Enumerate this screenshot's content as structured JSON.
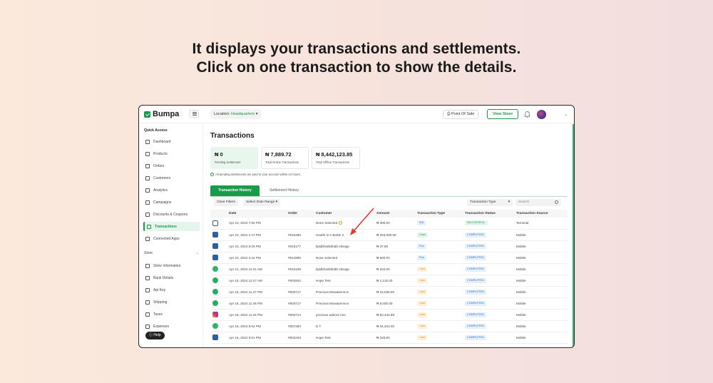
{
  "headline": {
    "line1": "It displays your transactions and settlements.",
    "line2": "Click on one transaction to show the details."
  },
  "app": {
    "logo": "Bumpa",
    "location_label": "Location:",
    "location_value": "Headquarters",
    "point_of_sale": "Point Of Sale",
    "view_store": "View Store"
  },
  "sidebar": {
    "quick_access": "Quick Access",
    "items": [
      {
        "label": "Dashboard",
        "icon": "grid-icon"
      },
      {
        "label": "Products",
        "icon": "tag-icon"
      },
      {
        "label": "Orders",
        "icon": "bag-icon"
      },
      {
        "label": "Customers",
        "icon": "user-icon"
      },
      {
        "label": "Analytics",
        "icon": "bar-chart-icon"
      },
      {
        "label": "Campaigns",
        "icon": "chat-icon"
      },
      {
        "label": "Discounts & Coupons",
        "icon": "percent-icon"
      },
      {
        "label": "Transactions",
        "icon": "swap-icon",
        "active": true
      },
      {
        "label": "Connected Apps",
        "icon": "apps-icon"
      }
    ],
    "store_section": "Store",
    "store_items": [
      {
        "label": "Store Information",
        "icon": "store-icon"
      },
      {
        "label": "Bank Details",
        "icon": "bank-icon"
      },
      {
        "label": "Api Key",
        "icon": "key-icon"
      },
      {
        "label": "Shipping",
        "icon": "truck-icon"
      },
      {
        "label": "Taxes",
        "icon": "tax-icon"
      },
      {
        "label": "Expenses",
        "icon": "receipt-icon"
      }
    ],
    "help": "Help"
  },
  "main": {
    "title": "Transactions",
    "stats": [
      {
        "value": "₦ 0",
        "label": "Pending Settlement"
      },
      {
        "value": "₦ 7,889.72",
        "label": "Total Online Transactions"
      },
      {
        "value": "₦ 8,442,123.85",
        "label": "Total Offline Transactions"
      }
    ],
    "notice": "All pending settlements are paid to your account within 24 hours.",
    "tabs": [
      "Transaction History",
      "Settlement History"
    ],
    "filters": {
      "clear": "Clear Filters",
      "date_range": "Select Date Range",
      "transaction_type": "Transaction Type",
      "search_placeholder": "Search"
    },
    "columns": [
      "",
      "Date",
      "Order",
      "Customer",
      "Amount",
      "Transaction Type",
      "Transaction Status",
      "Transaction Source"
    ],
    "rows": [
      {
        "src": "terminal",
        "date": "Apr 23, 2024 7:55 PM",
        "order": "",
        "customer": "None Selected",
        "info": true,
        "amount": "₦ 300.00",
        "type": "N/A",
        "type_cls": "na",
        "status": "SUCCESSFUL",
        "status_cls": "successful",
        "source": "Terminal"
      },
      {
        "src": "web",
        "date": "Apr 23, 2024 1:47 PM",
        "order": "#816486",
        "customer": "Health In A Bottle 2",
        "info": false,
        "amount": "₦ 293,000.00",
        "type": "Cash",
        "type_cls": "cash",
        "status": "COMPLETED",
        "status_cls": "completed",
        "source": "Mobile"
      },
      {
        "src": "web",
        "date": "Apr 22, 2024 8:25 PM",
        "order": "#815177",
        "customer": "bjsdbhsdsbhdb mksaja",
        "info": false,
        "amount": "₦ 37.80",
        "type": "Pos",
        "type_cls": "pos",
        "status": "COMPLETED",
        "status_cls": "completed",
        "source": "Mobile"
      },
      {
        "src": "web",
        "date": "Apr 22, 2024 2:44 PM",
        "order": "#814985",
        "customer": "None Selected",
        "info": false,
        "amount": "₦ 500.00",
        "type": "Pos",
        "type_cls": "pos",
        "status": "COMPLETED",
        "status_cls": "completed",
        "source": "Mobile"
      },
      {
        "src": "bumpa",
        "date": "Apr 21, 2024 11:21 AM",
        "order": "#810108",
        "customer": "bjsdbhsdsbhdb mksaja",
        "info": false,
        "amount": "₦ 202.00",
        "type": "Card",
        "type_cls": "card",
        "status": "COMPLETED",
        "status_cls": "completed",
        "source": "Mobile"
      },
      {
        "src": "wa",
        "date": "Apr 19, 2024 12:47 AM",
        "order": "#803932",
        "customer": "Hope Test",
        "info": false,
        "amount": "₦ 1,132.00",
        "type": "Card",
        "type_cls": "card",
        "status": "COMPLETED",
        "status_cls": "completed",
        "source": "Mobile"
      },
      {
        "src": "wa",
        "date": "Apr 18, 2024 11:47 PM",
        "order": "#803717",
        "customer": "Precious Mowaiemnce",
        "info": false,
        "amount": "₦ 24,030.00",
        "type": "Card",
        "type_cls": "card",
        "status": "COMPLETED",
        "status_cls": "completed",
        "source": "Mobile"
      },
      {
        "src": "wa",
        "date": "Apr 18, 2024 11:46 PM",
        "order": "#803717",
        "customer": "Precious Mowaiemnce",
        "info": false,
        "amount": "₦ 6,000.00",
        "type": "Card",
        "type_cls": "card",
        "status": "COMPLETED",
        "status_cls": "completed",
        "source": "Mobile"
      },
      {
        "src": "ig",
        "date": "Apr 18, 2024 11:44 PM",
        "order": "#803714",
        "customer": "precious adeora nne",
        "info": false,
        "amount": "₦ 53,432.88",
        "type": "Card",
        "type_cls": "card",
        "status": "COMPLETED",
        "status_cls": "completed",
        "source": "Mobile"
      },
      {
        "src": "bumpa",
        "date": "Apr 18, 2024 6:54 PM",
        "order": "#807250",
        "customer": "D T",
        "info": false,
        "amount": "₦ 54,234.00",
        "type": "Card",
        "type_cls": "card",
        "status": "COMPLETED",
        "status_cls": "completed",
        "source": "Mobile"
      },
      {
        "src": "web",
        "date": "Apr 18, 2024 5:51 PM",
        "order": "#803183",
        "customer": "Hope Test",
        "info": false,
        "amount": "₦ 345.00",
        "type": "Card",
        "type_cls": "card",
        "status": "COMPLETED",
        "status_cls": "completed",
        "source": "Mobile"
      }
    ]
  },
  "colors": {
    "brand": "#1a9a4b",
    "arrow": "#e53935"
  }
}
